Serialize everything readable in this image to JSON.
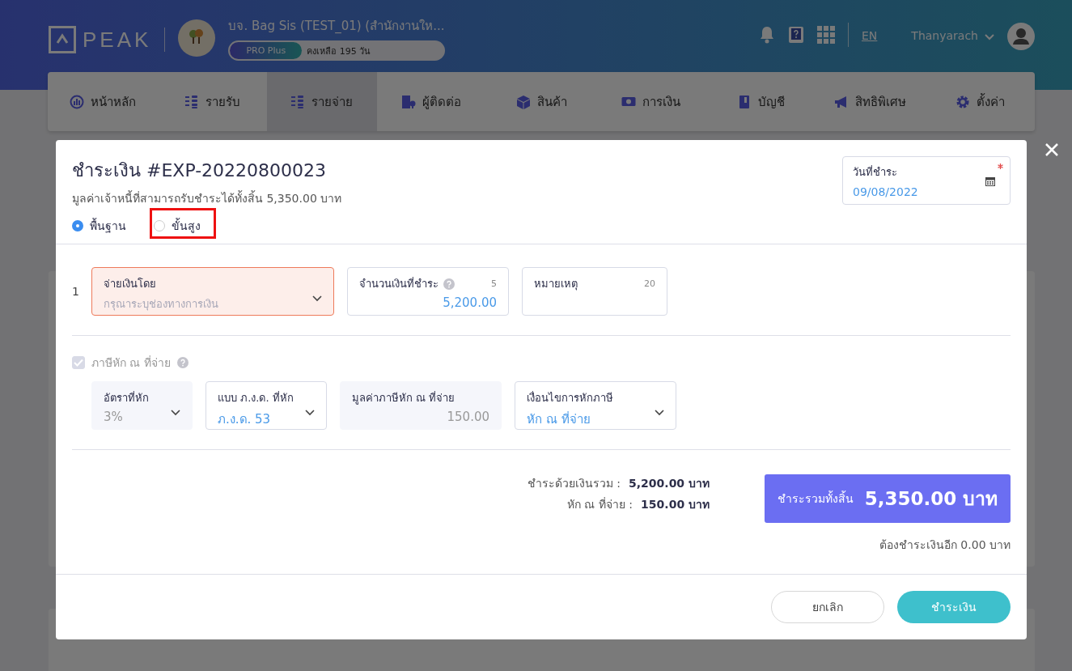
{
  "header": {
    "logo": "PEAK",
    "company": "บจ. Bag Sis (TEST_01) (สำนักงานให...",
    "plan": "PRO Plus",
    "remaining": "คงเหลือ 195 วัน",
    "language": "EN",
    "user": "Thanyarach"
  },
  "nav": [
    {
      "label": "หน้าหลัก",
      "selected": false
    },
    {
      "label": "รายรับ",
      "selected": false
    },
    {
      "label": "รายจ่าย",
      "selected": true
    },
    {
      "label": "ผู้ติดต่อ",
      "selected": false
    },
    {
      "label": "สินค้า",
      "selected": false
    },
    {
      "label": "การเงิน",
      "selected": false
    },
    {
      "label": "บัญชี",
      "selected": false
    },
    {
      "label": "สิทธิพิเศษ",
      "selected": false
    },
    {
      "label": "ตั้งค่า",
      "selected": false
    }
  ],
  "dialog": {
    "title": "ชำระเงิน #EXP-20220800023",
    "subtitle": "มูลค่าเจ้าหนี้ที่สามารถรับชำระได้ทั้งสิ้น 5,350.00 บาท",
    "modes": [
      {
        "label": "พื้นฐาน",
        "selected": true
      },
      {
        "label": "ขั้นสูง",
        "selected": false
      }
    ],
    "date": {
      "label": "วันที่ชำระ",
      "value": "09/08/2022",
      "required": true
    },
    "payment": {
      "index": "1",
      "method": {
        "label": "จ่ายเงินโดย",
        "placeholder": "กรุณาระบุช่องทางการเงิน",
        "error": true
      },
      "amount": {
        "label": "จำนวนเงินที่ชำระ",
        "count": "5",
        "value": "5,200.00"
      },
      "note": {
        "label": "หมายเหตุ",
        "count": "20"
      }
    },
    "withholding": {
      "label": "ภาษีหัก ณ ที่จ่าย",
      "checked": true,
      "disabled": true,
      "fields": [
        {
          "kind": "select",
          "label": "อัตราที่หัก",
          "value": "3%",
          "disabled": true
        },
        {
          "kind": "select",
          "label": "แบบ ภ.ง.ด. ที่หัก",
          "value": "ภ.ง.ด. 53",
          "disabled": false
        },
        {
          "kind": "readonly",
          "label": "มูลค่าภาษีหัก ณ ที่จ่าย",
          "value": "150.00",
          "disabled": true
        },
        {
          "kind": "select",
          "label": "เงื่อนไขการหักภาษี",
          "value": "หัก ณ ที่จ่าย",
          "disabled": false
        }
      ]
    },
    "summary": [
      {
        "label": "ชำระด้วยเงินรวม :",
        "value": "5,200.00 บาท"
      },
      {
        "label": "หัก ณ ที่จ่าย :",
        "value": "150.00 บาท"
      }
    ],
    "total": {
      "label": "ชำระรวมทั้งสิ้น",
      "amount": "5,350.00 บาท"
    },
    "outstanding": "ต้องชำระเงินอีก 0.00 บาท",
    "buttons": [
      {
        "kind": "secondary",
        "label": "ยกเลิก"
      },
      {
        "kind": "primary",
        "label": "ชำระเงิน"
      }
    ]
  }
}
